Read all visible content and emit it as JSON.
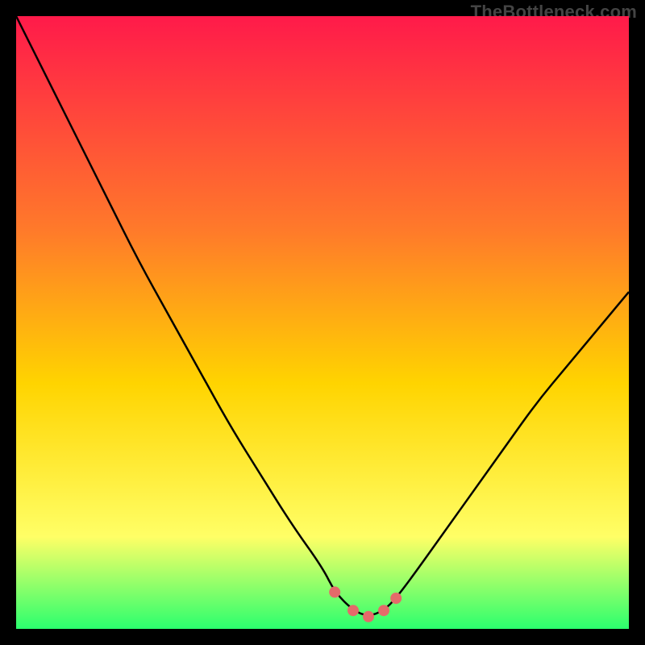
{
  "watermark": "TheBottleneck.com",
  "colors": {
    "background": "#000000",
    "gradient_top": "#ff1a4a",
    "gradient_mid1": "#ff7a2a",
    "gradient_mid2": "#ffd400",
    "gradient_mid3": "#ffff66",
    "gradient_bottom": "#2bff6e",
    "curve": "#000000",
    "marker": "#e46a6a"
  },
  "chart_data": {
    "type": "line",
    "title": "",
    "xlabel": "",
    "ylabel": "",
    "xlim": [
      0,
      100
    ],
    "ylim": [
      0,
      100
    ],
    "series": [
      {
        "name": "bottleneck-curve",
        "x": [
          0,
          5,
          10,
          15,
          20,
          25,
          30,
          35,
          40,
          45,
          50,
          52,
          55,
          57.5,
          60,
          62,
          65,
          70,
          75,
          80,
          85,
          90,
          95,
          100
        ],
        "y": [
          100,
          90,
          80,
          70,
          60,
          51,
          42,
          33,
          25,
          17,
          10,
          6,
          3,
          2,
          3,
          5,
          9,
          16,
          23,
          30,
          37,
          43,
          49,
          55
        ]
      }
    ],
    "markers": [
      {
        "name": "left-shoulder",
        "x": 52,
        "y": 6
      },
      {
        "name": "left-inner",
        "x": 55,
        "y": 3
      },
      {
        "name": "valley-min",
        "x": 57.5,
        "y": 2
      },
      {
        "name": "right-inner",
        "x": 60,
        "y": 3
      },
      {
        "name": "right-shoulder",
        "x": 62,
        "y": 5
      }
    ]
  }
}
